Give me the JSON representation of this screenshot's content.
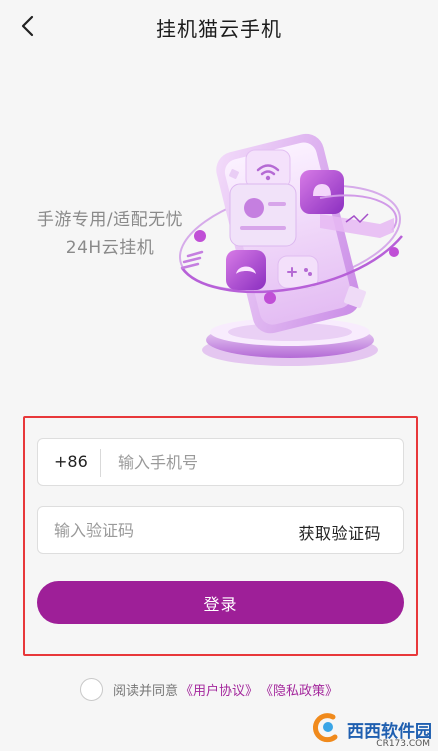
{
  "header": {
    "back_icon": "chevron-left-icon",
    "title": "挂机猫云手机"
  },
  "hero": {
    "slogan_line1": "手游专用/适配无忧",
    "slogan_line2": "24H云挂机",
    "illustration": "purple-cloud-phone-illustration"
  },
  "form": {
    "country_code": "+86",
    "phone_placeholder": "输入手机号",
    "phone_value": "",
    "code_placeholder": "输入验证码",
    "code_value": "",
    "get_code_label": "获取验证码",
    "login_label": "登录"
  },
  "agreement": {
    "text": "阅读并同意",
    "user_agreement": "《用户协议》",
    "privacy_policy": "《隐私政策》"
  },
  "watermark": {
    "brand": "西西软件园",
    "sub": "CR173.COM"
  },
  "colors": {
    "accent": "#9e1f98",
    "highlight_border": "#e8383a",
    "link": "#a4289d"
  }
}
